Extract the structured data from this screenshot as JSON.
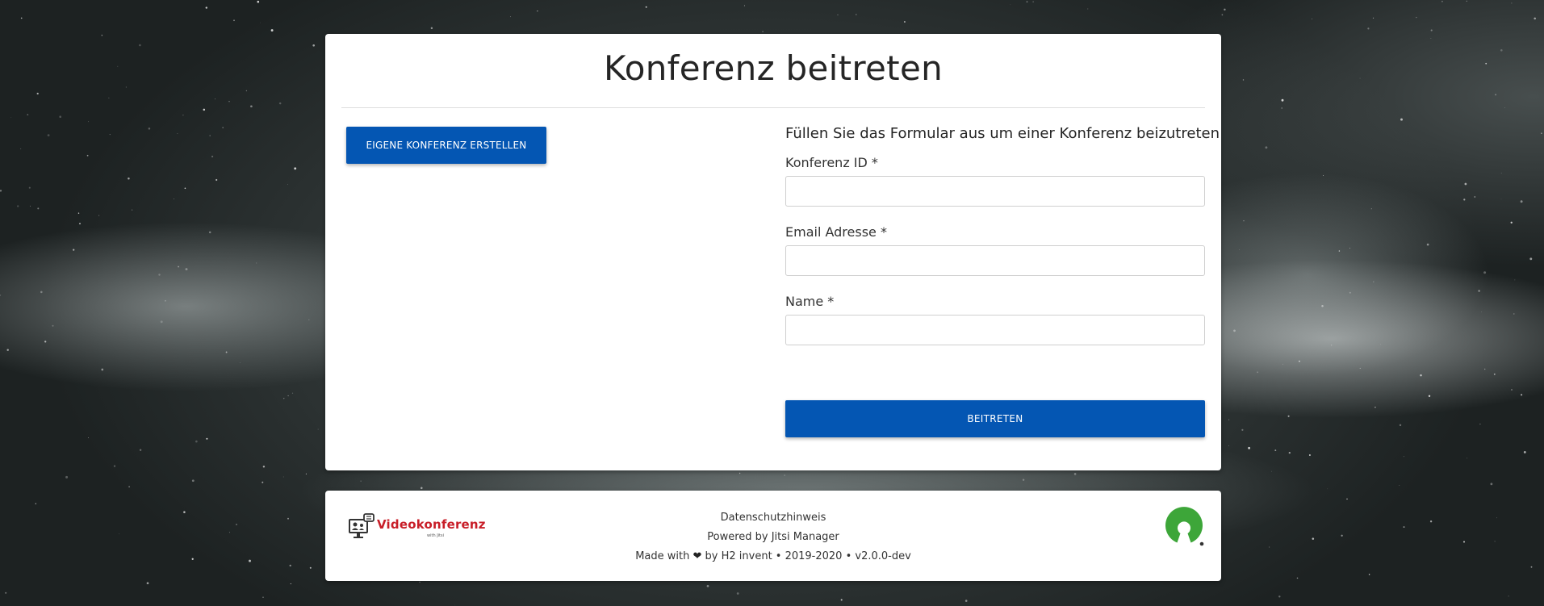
{
  "page": {
    "title": "Konferenz beitreten"
  },
  "left": {
    "create_button_label": "EIGENE KONFERENZ ERSTELLEN"
  },
  "form": {
    "heading": "Füllen Sie das Formular aus um einer Konferenz beizutreten",
    "fields": [
      {
        "label": "Konferenz ID *",
        "value": "",
        "placeholder": ""
      },
      {
        "label": "Email Adresse *",
        "value": "",
        "placeholder": ""
      },
      {
        "label": "Name *",
        "value": "",
        "placeholder": ""
      }
    ],
    "submit_label": "BEITRETEN"
  },
  "footer": {
    "logo_text": "Videokonferenz",
    "logo_subtext": "with Jitsi",
    "privacy_link": "Datenschutzhinweis",
    "powered_by": "Powered by Jitsi Manager",
    "made_with_prefix": "Made with",
    "made_with_suffix": "by H2 invent • 2019-2020 • v2.0.0-dev",
    "heart_icon": "heart-icon",
    "osi_icon": "open-source-initiative-icon"
  },
  "colors": {
    "primary_button": "#0456b3",
    "logo_red": "#c81e28",
    "osi_green": "#3da639"
  }
}
